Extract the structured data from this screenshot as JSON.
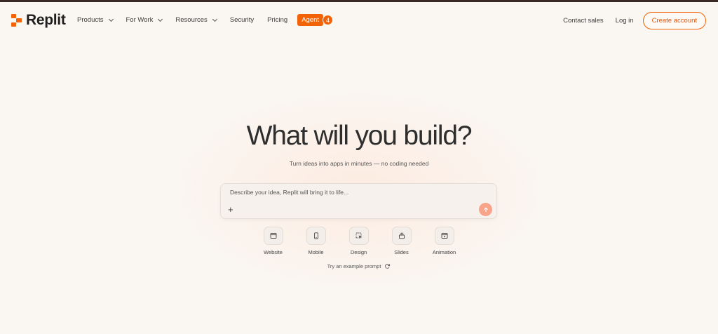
{
  "brand": {
    "name": "Replit",
    "accent": "#f26207"
  },
  "nav": {
    "menu": [
      {
        "label": "Products",
        "dropdown": true
      },
      {
        "label": "For Work",
        "dropdown": true
      },
      {
        "label": "Resources",
        "dropdown": true
      },
      {
        "label": "Security",
        "dropdown": false
      },
      {
        "label": "Pricing",
        "dropdown": false
      }
    ],
    "agent_label": "Agent",
    "agent_badge": "4",
    "contact_label": "Contact sales",
    "login_label": "Log in",
    "create_label": "Create account"
  },
  "hero": {
    "title": "What will you build?",
    "subtitle": "Turn ideas into apps in minutes — no coding needed",
    "placeholder": "Describe your idea, Replit will bring it to life...",
    "plus_icon": "plus-icon",
    "send_icon": "arrow-up-icon"
  },
  "categories": [
    {
      "label": "Website",
      "icon": "browser-window-icon"
    },
    {
      "label": "Mobile",
      "icon": "phone-icon"
    },
    {
      "label": "Design",
      "icon": "design-cursor-icon"
    },
    {
      "label": "Slides",
      "icon": "slides-stack-icon"
    },
    {
      "label": "Animation",
      "icon": "animation-frame-icon"
    }
  ],
  "example_prompt_label": "Try an example prompt"
}
